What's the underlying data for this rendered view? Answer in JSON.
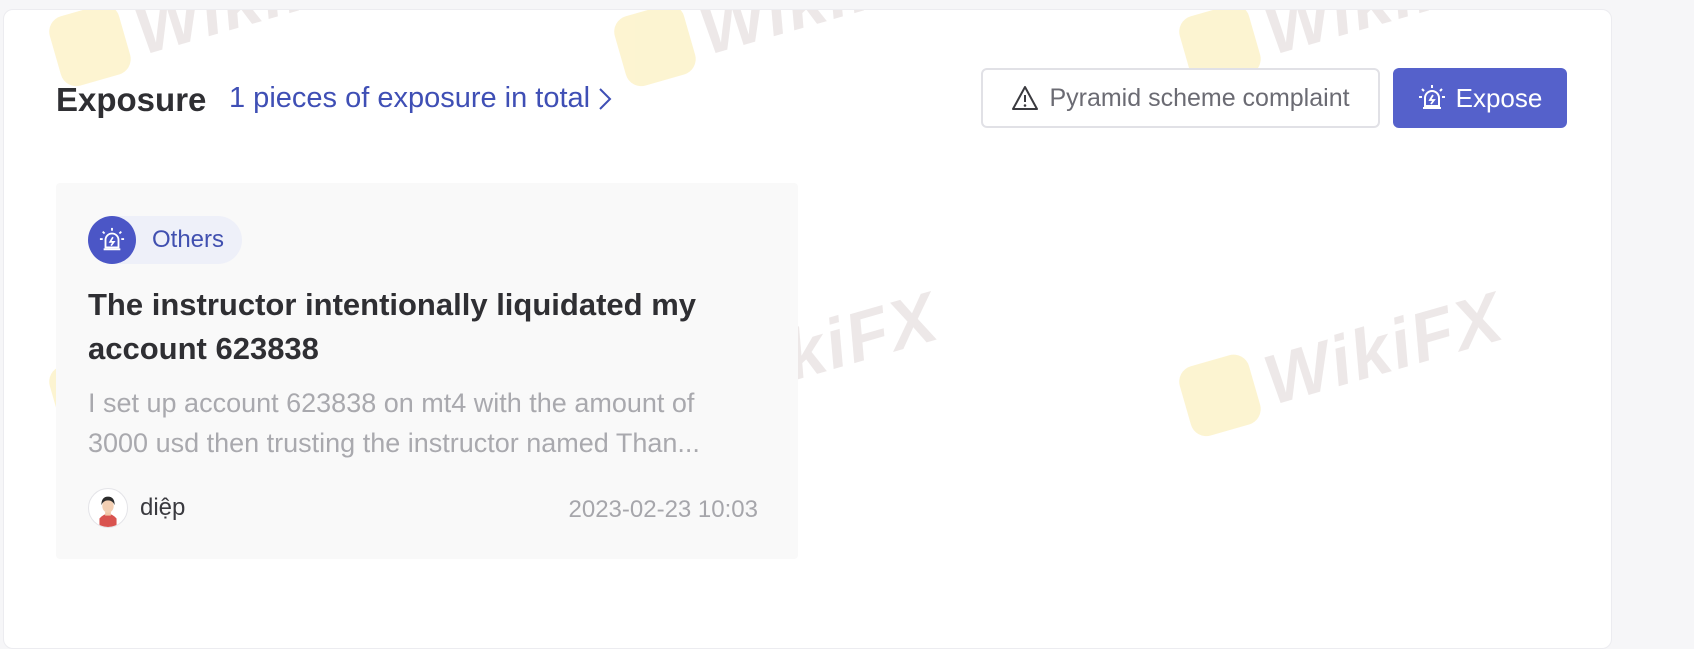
{
  "header": {
    "title": "Exposure",
    "total_link": "1 pieces of exposure in total",
    "complaint_button": "Pyramid scheme complaint",
    "expose_button": "Expose"
  },
  "watermark": {
    "text": "WikiFX"
  },
  "card": {
    "tag": "Others",
    "title": "The instructor intentionally liquidated my account 623838",
    "excerpt_lines": [
      "I set up account 623838 on mt4 with the amount of",
      "3000 usd then trusting the instructor named Than..."
    ],
    "author": "diệp",
    "date": "2023-02-23 10:03"
  },
  "colors": {
    "accent": "#5561cb",
    "link": "#3f4fb5"
  },
  "icons": {
    "complaint": "warning-triangle-icon",
    "expose": "alarm-light-icon",
    "link_chevron": "chevron-right-icon",
    "tag": "alarm-light-icon",
    "author_avatar": "person-avatar-icon"
  }
}
